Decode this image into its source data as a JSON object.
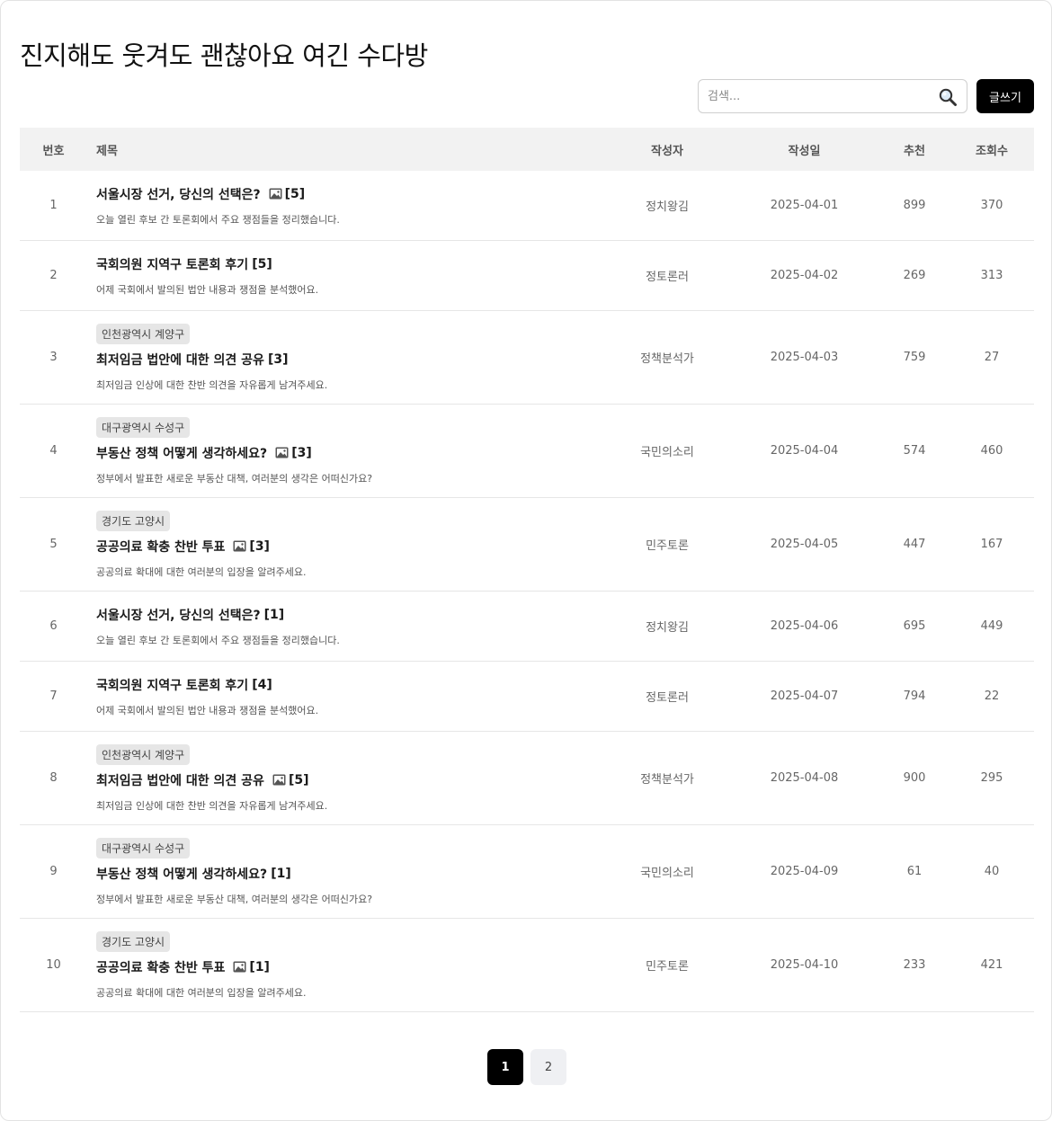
{
  "board": {
    "title": "진지해도 웃겨도 괜찮아요 여긴 수다방"
  },
  "search": {
    "placeholder": "검색...",
    "value": ""
  },
  "toolbar": {
    "write_label": "글쓰기"
  },
  "table": {
    "headers": {
      "no": "번호",
      "title": "제목",
      "author": "작성자",
      "date": "작성일",
      "likes": "추천",
      "views": "조회수"
    }
  },
  "posts": [
    {
      "no": "1",
      "region": "",
      "title": "서울시장 선거, 당신의 선택은?",
      "has_image": true,
      "comments": "[5]",
      "excerpt": "오늘 열린 후보 간 토론회에서 주요 쟁점들을 정리했습니다.",
      "author": "정치왕김",
      "date": "2025-04-01",
      "likes": "899",
      "views": "370"
    },
    {
      "no": "2",
      "region": "",
      "title": "국회의원 지역구 토론회 후기",
      "has_image": false,
      "comments": "[5]",
      "excerpt": "어제 국회에서 발의된 법안 내용과 쟁점을 분석했어요.",
      "author": "정토론러",
      "date": "2025-04-02",
      "likes": "269",
      "views": "313"
    },
    {
      "no": "3",
      "region": "인천광역시 계양구",
      "title": "최저임금 법안에 대한 의견 공유",
      "has_image": false,
      "comments": "[3]",
      "excerpt": "최저임금 인상에 대한 찬반 의견을 자유롭게 남겨주세요.",
      "author": "정책분석가",
      "date": "2025-04-03",
      "likes": "759",
      "views": "27"
    },
    {
      "no": "4",
      "region": "대구광역시 수성구",
      "title": "부동산 정책 어떻게 생각하세요?",
      "has_image": true,
      "comments": "[3]",
      "excerpt": "정부에서 발표한 새로운 부동산 대책, 여러분의 생각은 어떠신가요?",
      "author": "국민의소리",
      "date": "2025-04-04",
      "likes": "574",
      "views": "460"
    },
    {
      "no": "5",
      "region": "경기도 고양시",
      "title": "공공의료 확충 찬반 투표",
      "has_image": true,
      "comments": "[3]",
      "excerpt": "공공의료 확대에 대한 여러분의 입장을 알려주세요.",
      "author": "민주토론",
      "date": "2025-04-05",
      "likes": "447",
      "views": "167"
    },
    {
      "no": "6",
      "region": "",
      "title": "서울시장 선거, 당신의 선택은?",
      "has_image": false,
      "comments": "[1]",
      "excerpt": "오늘 열린 후보 간 토론회에서 주요 쟁점들을 정리했습니다.",
      "author": "정치왕김",
      "date": "2025-04-06",
      "likes": "695",
      "views": "449"
    },
    {
      "no": "7",
      "region": "",
      "title": "국회의원 지역구 토론회 후기",
      "has_image": false,
      "comments": "[4]",
      "excerpt": "어제 국회에서 발의된 법안 내용과 쟁점을 분석했어요.",
      "author": "정토론러",
      "date": "2025-04-07",
      "likes": "794",
      "views": "22"
    },
    {
      "no": "8",
      "region": "인천광역시 계양구",
      "title": "최저임금 법안에 대한 의견 공유",
      "has_image": true,
      "comments": "[5]",
      "excerpt": "최저임금 인상에 대한 찬반 의견을 자유롭게 남겨주세요.",
      "author": "정책분석가",
      "date": "2025-04-08",
      "likes": "900",
      "views": "295"
    },
    {
      "no": "9",
      "region": "대구광역시 수성구",
      "title": "부동산 정책 어떻게 생각하세요?",
      "has_image": false,
      "comments": "[1]",
      "excerpt": "정부에서 발표한 새로운 부동산 대책, 여러분의 생각은 어떠신가요?",
      "author": "국민의소리",
      "date": "2025-04-09",
      "likes": "61",
      "views": "40"
    },
    {
      "no": "10",
      "region": "경기도 고양시",
      "title": "공공의료 확충 찬반 투표",
      "has_image": true,
      "comments": "[1]",
      "excerpt": "공공의료 확대에 대한 여러분의 입장을 알려주세요.",
      "author": "민주토론",
      "date": "2025-04-10",
      "likes": "233",
      "views": "421"
    }
  ],
  "pagination": {
    "pages": [
      "1",
      "2"
    ],
    "current": "1"
  },
  "icons": {
    "search": "search-icon",
    "image": "image-icon"
  }
}
